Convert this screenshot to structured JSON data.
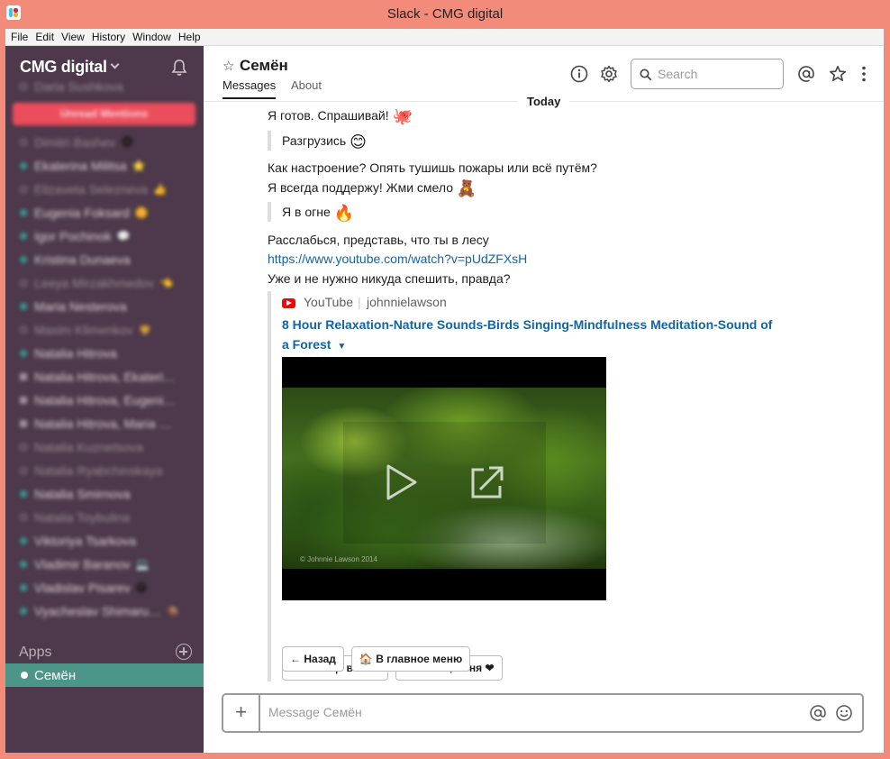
{
  "window": {
    "title": "Slack - CMG digital"
  },
  "menu": [
    "File",
    "Edit",
    "View",
    "History",
    "Window",
    "Help"
  ],
  "sidebar": {
    "workspace": "CMG digital",
    "unread_mentions": "Unread Mentions",
    "dms": [
      {
        "name": "Daria Sushkova",
        "status": "away",
        "emoji": ""
      },
      {
        "name": "Dimitri Bashev",
        "status": "away",
        "emoji": "🐵"
      },
      {
        "name": "Ekaterina Militsa",
        "status": "online",
        "emoji": "⭐"
      },
      {
        "name": "Elizaveta Selezneva",
        "status": "away",
        "emoji": "👍"
      },
      {
        "name": "Eugenia Foksard",
        "status": "online",
        "emoji": "🌼"
      },
      {
        "name": "Igor Pochinok",
        "status": "online",
        "emoji": "💬"
      },
      {
        "name": "Kristina Dunaeva",
        "status": "online",
        "emoji": ""
      },
      {
        "name": "Leeya Mirzakhmedov",
        "status": "away",
        "emoji": "👈"
      },
      {
        "name": "Maria Nesterova",
        "status": "online",
        "emoji": ""
      },
      {
        "name": "Maxim Klimenkov",
        "status": "away",
        "emoji": "🦁"
      },
      {
        "name": "Natalia Hitrova",
        "status": "online",
        "emoji": ""
      },
      {
        "name": "Natalia Hitrova, Ekaterina…",
        "status": "group",
        "emoji": ""
      },
      {
        "name": "Natalia Hitrova, Eugenia…",
        "status": "group",
        "emoji": ""
      },
      {
        "name": "Natalia Hitrova, Maria …",
        "status": "group",
        "emoji": ""
      },
      {
        "name": "Natalia Kuznetsova",
        "status": "away",
        "emoji": ""
      },
      {
        "name": "Natalia Ryabchinskaya",
        "status": "away",
        "emoji": ""
      },
      {
        "name": "Natalia Smirnova",
        "status": "online",
        "emoji": ""
      },
      {
        "name": "Natalia Toybulina",
        "status": "away",
        "emoji": ""
      },
      {
        "name": "Viktoriya Tsarkova",
        "status": "online",
        "emoji": ""
      },
      {
        "name": "Vladimir Baranov",
        "status": "online",
        "emoji": "💻"
      },
      {
        "name": "Vladislav Pisarev",
        "status": "online",
        "emoji": "😷"
      },
      {
        "name": "Vyacheslav Shimaru…",
        "status": "online",
        "emoji": "🏇"
      }
    ],
    "apps_label": "Apps",
    "active_app": "Семён"
  },
  "header": {
    "channel_name": "Семён",
    "tabs": [
      "Messages",
      "About"
    ],
    "search_placeholder": "Search"
  },
  "date_divider": "Today",
  "messages": {
    "m1": "Я готов. Спрашивай!",
    "m1_emoji": "🐙",
    "q1": "Разгрузись",
    "q1_emoji": "😊",
    "m2a": "Как настроение? Опять тушишь пожары или всё путём?",
    "m2b": "Я всегда поддержу! Жми смело",
    "m2b_emoji": "🧸",
    "q2": "Я в огне",
    "q2_emoji": "🔥",
    "m3a": "Расслабься, представь, что ты в лесу",
    "m3_link": "https://www.youtube.com/watch?v=pUdZFXsH",
    "m3b": "Уже и не нужно никуда спешить, правда?"
  },
  "attachment": {
    "service": "YouTube",
    "author": "johnnielawson",
    "title": "8 Hour Relaxation-Nature Sounds-Birds Singing-Mindfulness Meditation-Sound of a Forest",
    "video_caption": "© Johnnie Lawson 2014"
  },
  "actions": {
    "row1": [
      "Я всё ещё в огне",
      "Спасибо, Сеня ❤"
    ],
    "row2": [
      "← Назад",
      "🏠 В главное меню"
    ]
  },
  "composer": {
    "placeholder": "Message Семён"
  },
  "colors": {
    "sidebar": "#4d394b",
    "active": "#4c9689",
    "link": "#1264a3",
    "titlebar": "#f28b7a"
  }
}
